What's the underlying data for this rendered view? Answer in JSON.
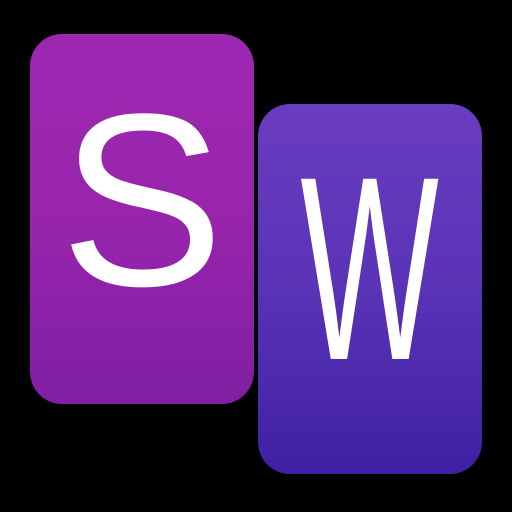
{
  "logo": {
    "letter_1": "S",
    "letter_2": "W"
  },
  "colors": {
    "background": "#000000",
    "tile_1_top": "#9d27b0",
    "tile_1_bottom": "#7f1fa2",
    "tile_2_top": "#6a3cc0",
    "tile_2_bottom": "#3f1fa4",
    "letter": "#ffffff"
  }
}
